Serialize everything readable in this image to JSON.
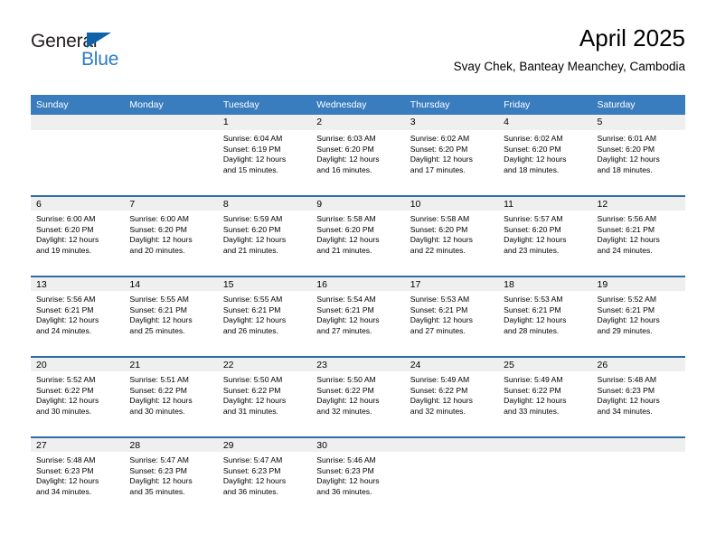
{
  "brand": {
    "name_dark": "General",
    "name_light": "Blue",
    "triangle_color": "#0f62a8",
    "blue_color": "#2b7cc4"
  },
  "header": {
    "title": "April 2025",
    "subtitle": "Svay Chek, Banteay Meanchey, Cambodia"
  },
  "theme": {
    "header_blue": "#3a7dbf",
    "rule_blue": "#2f6da8",
    "band_gray": "#efefef"
  },
  "weekdays": [
    "Sunday",
    "Monday",
    "Tuesday",
    "Wednesday",
    "Thursday",
    "Friday",
    "Saturday"
  ],
  "weeks": [
    [
      {
        "day": "",
        "sunrise": "",
        "sunset": "",
        "daylight1": "",
        "daylight2": ""
      },
      {
        "day": "",
        "sunrise": "",
        "sunset": "",
        "daylight1": "",
        "daylight2": ""
      },
      {
        "day": "1",
        "sunrise": "Sunrise: 6:04 AM",
        "sunset": "Sunset: 6:19 PM",
        "daylight1": "Daylight: 12 hours",
        "daylight2": "and 15 minutes."
      },
      {
        "day": "2",
        "sunrise": "Sunrise: 6:03 AM",
        "sunset": "Sunset: 6:20 PM",
        "daylight1": "Daylight: 12 hours",
        "daylight2": "and 16 minutes."
      },
      {
        "day": "3",
        "sunrise": "Sunrise: 6:02 AM",
        "sunset": "Sunset: 6:20 PM",
        "daylight1": "Daylight: 12 hours",
        "daylight2": "and 17 minutes."
      },
      {
        "day": "4",
        "sunrise": "Sunrise: 6:02 AM",
        "sunset": "Sunset: 6:20 PM",
        "daylight1": "Daylight: 12 hours",
        "daylight2": "and 18 minutes."
      },
      {
        "day": "5",
        "sunrise": "Sunrise: 6:01 AM",
        "sunset": "Sunset: 6:20 PM",
        "daylight1": "Daylight: 12 hours",
        "daylight2": "and 18 minutes."
      }
    ],
    [
      {
        "day": "6",
        "sunrise": "Sunrise: 6:00 AM",
        "sunset": "Sunset: 6:20 PM",
        "daylight1": "Daylight: 12 hours",
        "daylight2": "and 19 minutes."
      },
      {
        "day": "7",
        "sunrise": "Sunrise: 6:00 AM",
        "sunset": "Sunset: 6:20 PM",
        "daylight1": "Daylight: 12 hours",
        "daylight2": "and 20 minutes."
      },
      {
        "day": "8",
        "sunrise": "Sunrise: 5:59 AM",
        "sunset": "Sunset: 6:20 PM",
        "daylight1": "Daylight: 12 hours",
        "daylight2": "and 21 minutes."
      },
      {
        "day": "9",
        "sunrise": "Sunrise: 5:58 AM",
        "sunset": "Sunset: 6:20 PM",
        "daylight1": "Daylight: 12 hours",
        "daylight2": "and 21 minutes."
      },
      {
        "day": "10",
        "sunrise": "Sunrise: 5:58 AM",
        "sunset": "Sunset: 6:20 PM",
        "daylight1": "Daylight: 12 hours",
        "daylight2": "and 22 minutes."
      },
      {
        "day": "11",
        "sunrise": "Sunrise: 5:57 AM",
        "sunset": "Sunset: 6:20 PM",
        "daylight1": "Daylight: 12 hours",
        "daylight2": "and 23 minutes."
      },
      {
        "day": "12",
        "sunrise": "Sunrise: 5:56 AM",
        "sunset": "Sunset: 6:21 PM",
        "daylight1": "Daylight: 12 hours",
        "daylight2": "and 24 minutes."
      }
    ],
    [
      {
        "day": "13",
        "sunrise": "Sunrise: 5:56 AM",
        "sunset": "Sunset: 6:21 PM",
        "daylight1": "Daylight: 12 hours",
        "daylight2": "and 24 minutes."
      },
      {
        "day": "14",
        "sunrise": "Sunrise: 5:55 AM",
        "sunset": "Sunset: 6:21 PM",
        "daylight1": "Daylight: 12 hours",
        "daylight2": "and 25 minutes."
      },
      {
        "day": "15",
        "sunrise": "Sunrise: 5:55 AM",
        "sunset": "Sunset: 6:21 PM",
        "daylight1": "Daylight: 12 hours",
        "daylight2": "and 26 minutes."
      },
      {
        "day": "16",
        "sunrise": "Sunrise: 5:54 AM",
        "sunset": "Sunset: 6:21 PM",
        "daylight1": "Daylight: 12 hours",
        "daylight2": "and 27 minutes."
      },
      {
        "day": "17",
        "sunrise": "Sunrise: 5:53 AM",
        "sunset": "Sunset: 6:21 PM",
        "daylight1": "Daylight: 12 hours",
        "daylight2": "and 27 minutes."
      },
      {
        "day": "18",
        "sunrise": "Sunrise: 5:53 AM",
        "sunset": "Sunset: 6:21 PM",
        "daylight1": "Daylight: 12 hours",
        "daylight2": "and 28 minutes."
      },
      {
        "day": "19",
        "sunrise": "Sunrise: 5:52 AM",
        "sunset": "Sunset: 6:21 PM",
        "daylight1": "Daylight: 12 hours",
        "daylight2": "and 29 minutes."
      }
    ],
    [
      {
        "day": "20",
        "sunrise": "Sunrise: 5:52 AM",
        "sunset": "Sunset: 6:22 PM",
        "daylight1": "Daylight: 12 hours",
        "daylight2": "and 30 minutes."
      },
      {
        "day": "21",
        "sunrise": "Sunrise: 5:51 AM",
        "sunset": "Sunset: 6:22 PM",
        "daylight1": "Daylight: 12 hours",
        "daylight2": "and 30 minutes."
      },
      {
        "day": "22",
        "sunrise": "Sunrise: 5:50 AM",
        "sunset": "Sunset: 6:22 PM",
        "daylight1": "Daylight: 12 hours",
        "daylight2": "and 31 minutes."
      },
      {
        "day": "23",
        "sunrise": "Sunrise: 5:50 AM",
        "sunset": "Sunset: 6:22 PM",
        "daylight1": "Daylight: 12 hours",
        "daylight2": "and 32 minutes."
      },
      {
        "day": "24",
        "sunrise": "Sunrise: 5:49 AM",
        "sunset": "Sunset: 6:22 PM",
        "daylight1": "Daylight: 12 hours",
        "daylight2": "and 32 minutes."
      },
      {
        "day": "25",
        "sunrise": "Sunrise: 5:49 AM",
        "sunset": "Sunset: 6:22 PM",
        "daylight1": "Daylight: 12 hours",
        "daylight2": "and 33 minutes."
      },
      {
        "day": "26",
        "sunrise": "Sunrise: 5:48 AM",
        "sunset": "Sunset: 6:23 PM",
        "daylight1": "Daylight: 12 hours",
        "daylight2": "and 34 minutes."
      }
    ],
    [
      {
        "day": "27",
        "sunrise": "Sunrise: 5:48 AM",
        "sunset": "Sunset: 6:23 PM",
        "daylight1": "Daylight: 12 hours",
        "daylight2": "and 34 minutes."
      },
      {
        "day": "28",
        "sunrise": "Sunrise: 5:47 AM",
        "sunset": "Sunset: 6:23 PM",
        "daylight1": "Daylight: 12 hours",
        "daylight2": "and 35 minutes."
      },
      {
        "day": "29",
        "sunrise": "Sunrise: 5:47 AM",
        "sunset": "Sunset: 6:23 PM",
        "daylight1": "Daylight: 12 hours",
        "daylight2": "and 36 minutes."
      },
      {
        "day": "30",
        "sunrise": "Sunrise: 5:46 AM",
        "sunset": "Sunset: 6:23 PM",
        "daylight1": "Daylight: 12 hours",
        "daylight2": "and 36 minutes."
      },
      {
        "day": "",
        "sunrise": "",
        "sunset": "",
        "daylight1": "",
        "daylight2": ""
      },
      {
        "day": "",
        "sunrise": "",
        "sunset": "",
        "daylight1": "",
        "daylight2": ""
      },
      {
        "day": "",
        "sunrise": "",
        "sunset": "",
        "daylight1": "",
        "daylight2": ""
      }
    ]
  ]
}
